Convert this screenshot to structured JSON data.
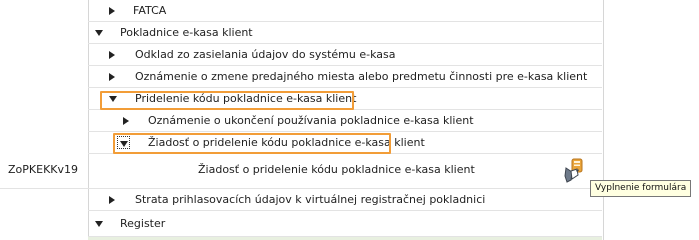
{
  "tree": {
    "items": [
      {
        "label": "FATCA"
      },
      {
        "label": "Pokladnice e-kasa klient"
      },
      {
        "label": "Odklad zo zasielania údajov do systému e-kasa"
      },
      {
        "label": "Oznámenie o zmene predajného miesta alebo predmetu činnosti pre e-kasa klient"
      },
      {
        "label": "Pridelenie kódu pokladnice e-kasa klient"
      },
      {
        "label": "Oznámenie o ukončení používania pokladnice e-kasa klient"
      },
      {
        "label": "Žiadosť o pridelenie kódu pokladnice e-kasa klient"
      },
      {
        "label": "Strata prihlasovacích údajov k virtuálnej registračnej pokladnici"
      },
      {
        "label": "Register"
      }
    ]
  },
  "document": {
    "code": "ZoPKEKKv19",
    "name": "Žiadosť o pridelenie kódu pokladnice e-kasa klient"
  },
  "tooltip": {
    "text": "Vyplnenie formulára"
  },
  "colors": {
    "highlight": "#f29d38",
    "tooltip_bg": "#ffffe1"
  },
  "icons": {
    "fill_form": "pencil-hand-icon"
  }
}
